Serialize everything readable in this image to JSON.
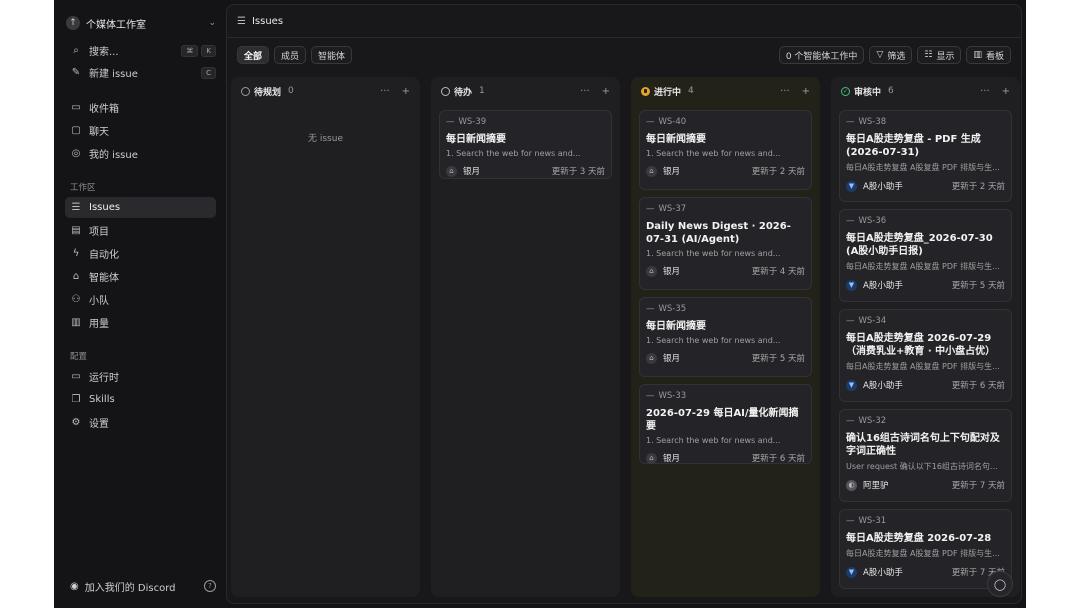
{
  "sidebar": {
    "workspace": {
      "name": "个媒体工作室",
      "icon": "arrow-up-icon"
    },
    "search": {
      "label": "搜索...",
      "kbd": [
        "⌘",
        "K"
      ]
    },
    "new_issue": {
      "label": "新建 issue",
      "kbd": "C"
    },
    "primary": [
      {
        "label": "收件箱",
        "icon": "inbox-icon"
      },
      {
        "label": "聊天",
        "icon": "chat-icon"
      },
      {
        "label": "我的 issue",
        "icon": "user-circle-icon"
      }
    ],
    "workspace_section_label": "工作区",
    "workspace_items": [
      {
        "label": "Issues",
        "icon": "list-check-icon",
        "active": true
      },
      {
        "label": "项目",
        "icon": "folder-icon"
      },
      {
        "label": "自动化",
        "icon": "bolt-icon"
      },
      {
        "label": "智能体",
        "icon": "robot-icon"
      },
      {
        "label": "小队",
        "icon": "team-icon"
      },
      {
        "label": "用量",
        "icon": "bar-chart-icon"
      }
    ],
    "config_section_label": "配置",
    "config_items": [
      {
        "label": "运行时",
        "icon": "monitor-icon"
      },
      {
        "label": "Skills",
        "icon": "book-icon"
      },
      {
        "label": "设置",
        "icon": "gear-icon"
      }
    ],
    "discord": {
      "label": "加入我们的 Discord"
    }
  },
  "topbar": {
    "title": "Issues"
  },
  "filters": {
    "tabs": [
      "全部",
      "成员",
      "智能体"
    ],
    "agents_working": "0 个智能体工作中",
    "filter_label": "筛选",
    "display_label": "显示",
    "board_label": "看板"
  },
  "columns": [
    {
      "title": "待规划",
      "count": "0",
      "empty_text": "无 issue",
      "cards": []
    },
    {
      "title": "待办",
      "count": "1",
      "cards": [
        {
          "id": "WS-39",
          "title": "每日新闻摘要",
          "desc": "1. Search the web for news and...",
          "assignee": "银月",
          "updated": "更新于 3 天前"
        }
      ]
    },
    {
      "title": "进行中",
      "count": "4",
      "cards": [
        {
          "id": "WS-40",
          "title": "每日新闻摘要",
          "desc": "1. Search the web for news and...",
          "assignee": "银月",
          "updated": "更新于 2 天前"
        },
        {
          "id": "WS-37",
          "title": "Daily News Digest · 2026-07-31 (AI/Agent)",
          "desc": "1. Search the web for news and...",
          "assignee": "银月",
          "updated": "更新于 4 天前"
        },
        {
          "id": "WS-35",
          "title": "每日新闻摘要",
          "desc": "1. Search the web for news and...",
          "assignee": "银月",
          "updated": "更新于 5 天前"
        },
        {
          "id": "WS-33",
          "title": "2026-07-29 每日AI/量化新闻摘要",
          "desc": "1. Search the web for news and...",
          "assignee": "银月",
          "updated": "更新于 6 天前"
        }
      ]
    },
    {
      "title": "审核中",
      "count": "6",
      "cards": [
        {
          "id": "WS-38",
          "title": "每日A股走势复盘 - PDF 生成 (2026-07-31)",
          "desc": "每日A股走势复盘 A股复盘 PDF 排版与生...",
          "assignee": "A股小助手",
          "updated": "更新于 2 天前"
        },
        {
          "id": "WS-36",
          "title": "每日A股走势复盘_2026-07-30 (A股小助手日报)",
          "desc": "每日A股走势复盘 A股复盘 PDF 排版与生...",
          "assignee": "A股小助手",
          "updated": "更新于 5 天前"
        },
        {
          "id": "WS-34",
          "title": "每日A股走势复盘 2026-07-29（消费乳业+教育 · 中小盘占优）",
          "desc": "每日A股走势复盘 A股复盘 PDF 排版与生...",
          "assignee": "A股小助手",
          "updated": "更新于 6 天前"
        },
        {
          "id": "WS-32",
          "title": "确认16组古诗词名句上下句配对及字词正确性",
          "desc": "User request 确认以下16组古诗词名句上...",
          "assignee": "阿里驴",
          "updated": "更新于 7 天前"
        },
        {
          "id": "WS-31",
          "title": "每日A股走势复盘 2026-07-28",
          "desc": "每日A股走势复盘 A股复盘 PDF 排版与生...",
          "assignee": "A股小助手",
          "updated": "更新于 7 天前"
        }
      ]
    }
  ],
  "colors": {
    "bg": "#141416",
    "panel": "#18181b",
    "progress": "#e0a52a",
    "review": "#3ac47a"
  }
}
